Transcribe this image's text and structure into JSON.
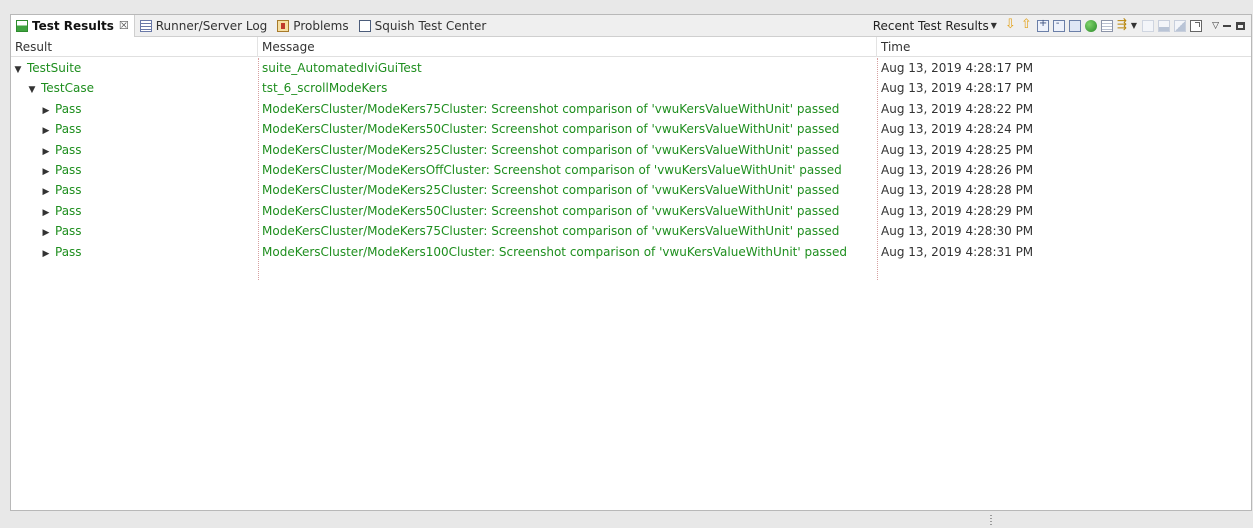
{
  "tabs": [
    {
      "label": "Test Results",
      "icon": "test-results-icon",
      "active": true,
      "close": "☒"
    },
    {
      "label": "Runner/Server Log",
      "icon": "log-icon",
      "active": false
    },
    {
      "label": "Problems",
      "icon": "problems-icon",
      "active": false
    },
    {
      "label": "Squish Test Center",
      "icon": "squish-test-center-icon",
      "active": false
    }
  ],
  "toolbar": {
    "recent_label": "Recent Test Results"
  },
  "columns": {
    "result": "Result",
    "message": "Message",
    "time": "Time"
  },
  "rows": [
    {
      "level": 0,
      "expander": "▼",
      "result": "TestSuite",
      "message": "suite_AutomatedIviGuiTest",
      "time": "Aug 13, 2019 4:28:17 PM"
    },
    {
      "level": 1,
      "expander": "▼",
      "result": "TestCase",
      "message": "tst_6_scrollModeKers",
      "time": "Aug 13, 2019 4:28:17 PM"
    },
    {
      "level": 2,
      "expander": "▶",
      "result": "Pass",
      "message": "ModeKersCluster/ModeKers75Cluster: Screenshot comparison of 'vwuKersValueWithUnit' passed",
      "time": "Aug 13, 2019 4:28:22 PM"
    },
    {
      "level": 2,
      "expander": "▶",
      "result": "Pass",
      "message": "ModeKersCluster/ModeKers50Cluster: Screenshot comparison of 'vwuKersValueWithUnit' passed",
      "time": "Aug 13, 2019 4:28:24 PM"
    },
    {
      "level": 2,
      "expander": "▶",
      "result": "Pass",
      "message": "ModeKersCluster/ModeKers25Cluster: Screenshot comparison of 'vwuKersValueWithUnit' passed",
      "time": "Aug 13, 2019 4:28:25 PM"
    },
    {
      "level": 2,
      "expander": "▶",
      "result": "Pass",
      "message": "ModeKersCluster/ModeKersOffCluster: Screenshot comparison of 'vwuKersValueWithUnit' passed",
      "time": "Aug 13, 2019 4:28:26 PM"
    },
    {
      "level": 2,
      "expander": "▶",
      "result": "Pass",
      "message": "ModeKersCluster/ModeKers25Cluster: Screenshot comparison of 'vwuKersValueWithUnit' passed",
      "time": "Aug 13, 2019 4:28:28 PM"
    },
    {
      "level": 2,
      "expander": "▶",
      "result": "Pass",
      "message": "ModeKersCluster/ModeKers50Cluster: Screenshot comparison of 'vwuKersValueWithUnit' passed",
      "time": "Aug 13, 2019 4:28:29 PM"
    },
    {
      "level": 2,
      "expander": "▶",
      "result": "Pass",
      "message": "ModeKersCluster/ModeKers75Cluster: Screenshot comparison of 'vwuKersValueWithUnit' passed",
      "time": "Aug 13, 2019 4:28:30 PM"
    },
    {
      "level": 2,
      "expander": "▶",
      "result": "Pass",
      "message": "ModeKersCluster/ModeKers100Cluster: Screenshot comparison of 'vwuKersValueWithUnit' passed",
      "time": "Aug 13, 2019 4:28:31 PM"
    }
  ],
  "colors": {
    "pass_text": "#1e8e1e",
    "accent_icon": "#e3a21a"
  }
}
